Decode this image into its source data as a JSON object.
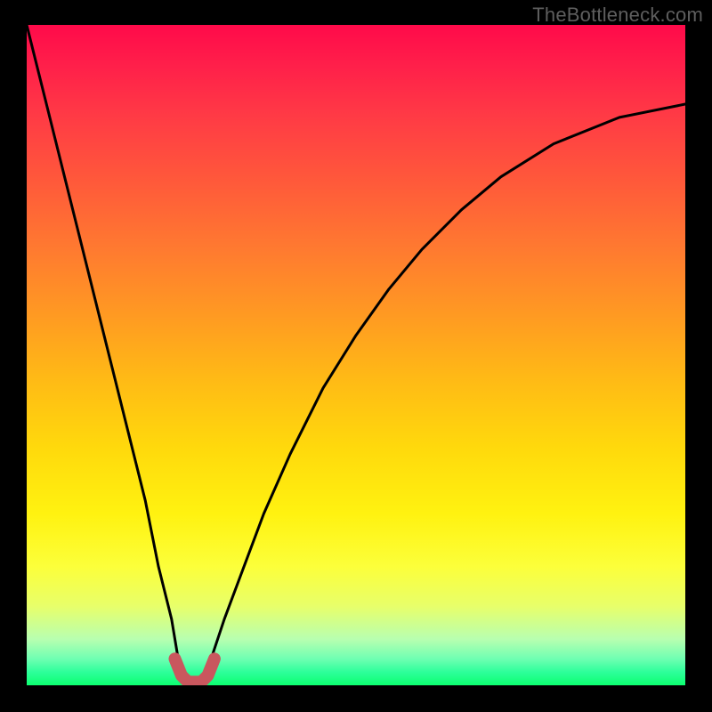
{
  "watermark": {
    "text": "TheBottleneck.com"
  },
  "chart_data": {
    "type": "line",
    "title": "",
    "xlabel": "",
    "ylabel": "",
    "xlim": [
      0,
      100
    ],
    "ylim": [
      0,
      100
    ],
    "series": [
      {
        "name": "bottleneck-curve",
        "x": [
          0,
          3,
          6,
          9,
          12,
          15,
          18,
          20,
          22,
          23,
          24,
          25,
          26,
          27,
          28,
          30,
          33,
          36,
          40,
          45,
          50,
          55,
          60,
          66,
          72,
          80,
          90,
          100
        ],
        "values": [
          100,
          88,
          76,
          64,
          52,
          40,
          28,
          18,
          10,
          4,
          1,
          0,
          0,
          1,
          4,
          10,
          18,
          26,
          35,
          45,
          53,
          60,
          66,
          72,
          77,
          82,
          86,
          88
        ]
      },
      {
        "name": "sweet-spot-marker",
        "x": [
          22.5,
          23.5,
          24.5,
          25.5,
          26.5,
          27.5,
          28.5
        ],
        "values": [
          4.0,
          1.5,
          0.5,
          0.5,
          0.5,
          1.5,
          4.0
        ]
      }
    ],
    "gradient_colors": {
      "top": "#ff0a4a",
      "mid": "#ffd90c",
      "bottom": "#0cff70"
    },
    "marker_color": "#c9575e"
  }
}
